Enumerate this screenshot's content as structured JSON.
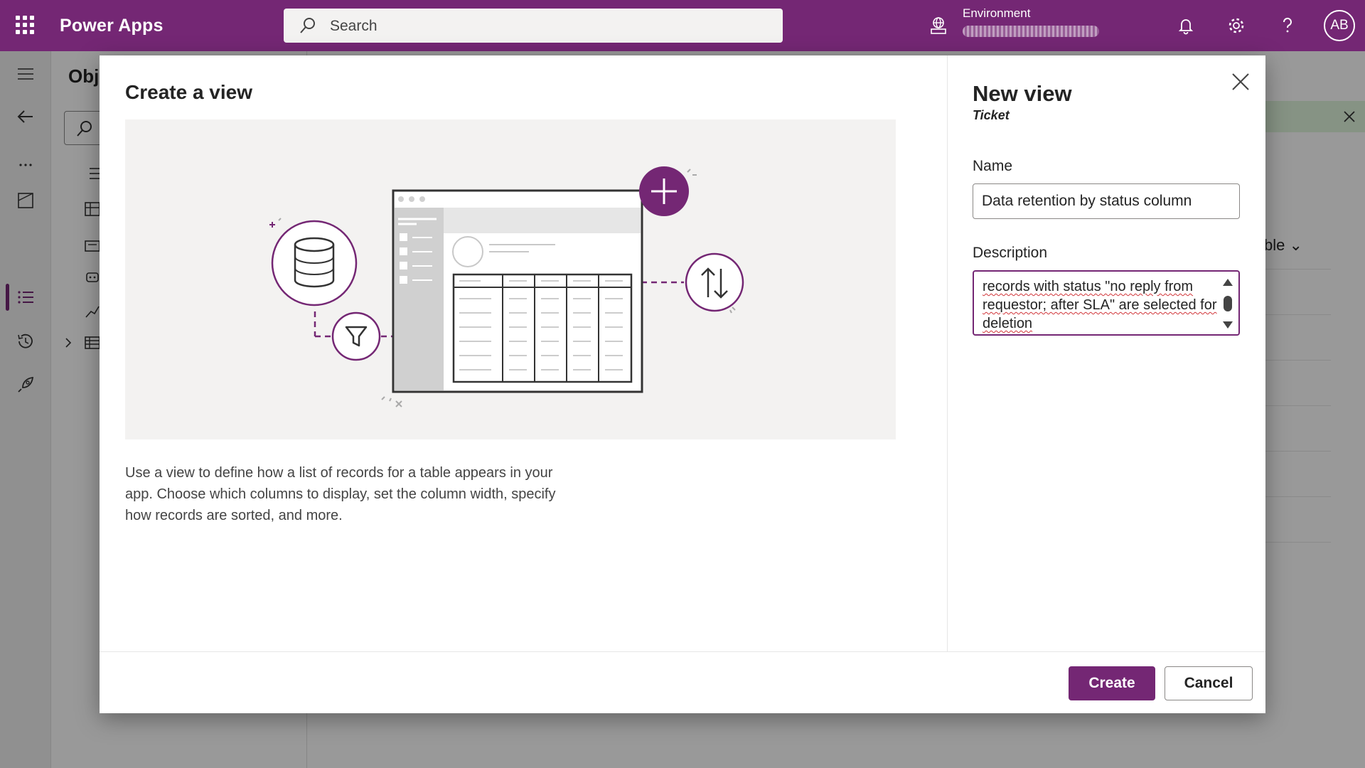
{
  "header": {
    "app_name": "Power Apps",
    "search_placeholder": "Search",
    "environment_label": "Environment",
    "avatar_initials": "AB"
  },
  "background": {
    "objects_title": "Obje",
    "column_label_fragment": "ble"
  },
  "dialog": {
    "left": {
      "title": "Create a view",
      "description": "Use a view to define how a list of records for a table appears in your app. Choose which columns to display, set the column width, specify how records are sorted, and more."
    },
    "right": {
      "title": "New view",
      "subtitle": "Ticket",
      "name_label": "Name",
      "name_value": "Data retention by status column",
      "description_label": "Description",
      "description_value": "records with status \"no reply from requestor; after SLA\" are selected for deletion"
    },
    "buttons": {
      "create": "Create",
      "cancel": "Cancel"
    }
  },
  "colors": {
    "brand": "#742774",
    "illustration_bg": "#f3f2f1",
    "spellcheck": "#d13438"
  },
  "icons": [
    "waffle-icon",
    "search-icon",
    "environment-icon",
    "bell-icon",
    "gear-icon",
    "help-icon",
    "close-icon",
    "database-icon",
    "filter-icon",
    "plus-icon",
    "sort-icon"
  ]
}
